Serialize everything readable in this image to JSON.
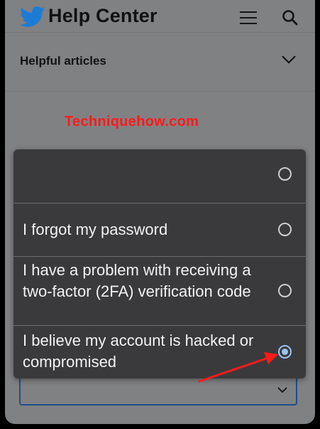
{
  "header": {
    "brand": "Help Center",
    "icons": {
      "logo": "twitter-bird-icon",
      "menu": "hamburger-menu-icon",
      "search": "search-icon"
    }
  },
  "articles": {
    "label": "Helpful articles"
  },
  "watermark": "Techniquehow.com",
  "options": [
    {
      "label": "",
      "selected": false
    },
    {
      "label": "I forgot my password",
      "selected": false
    },
    {
      "label": "I have a problem with receiving a two-factor (2FA) verification code",
      "selected": false
    },
    {
      "label": "I believe my account is hacked or compromised",
      "selected": true
    }
  ],
  "colors": {
    "accent": "#9cc4f2",
    "sheet": "#3a3a3c",
    "annotation_arrow": "#ff1a1a",
    "twitter_blue": "#1d7bd6"
  }
}
